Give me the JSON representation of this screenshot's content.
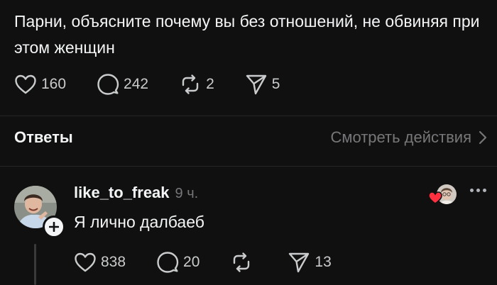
{
  "post": {
    "text": "Парни, объясните почему вы без отношений, не обвиняя при этом женщин",
    "likes": "160",
    "comments": "242",
    "reposts": "2",
    "shares": "5"
  },
  "replies_header": {
    "title": "Ответы",
    "view_activity": "Смотреть действия"
  },
  "reply": {
    "username": "like_to_freak",
    "time": "9 ч.",
    "text": "Я лично далбаеб",
    "likes": "838",
    "comments": "20",
    "reposts": "",
    "shares": "13"
  },
  "icons": {
    "like": "heart-icon",
    "comment": "comment-bubble-icon",
    "repost": "repost-icon",
    "share": "send-icon",
    "more": "more-dots-icon",
    "follow": "plus-icon",
    "chevron": "chevron-right-icon"
  },
  "colors": {
    "background": "#101010",
    "text": "#f3f5f7",
    "muted": "#77777a",
    "like_red": "#ff3040"
  }
}
